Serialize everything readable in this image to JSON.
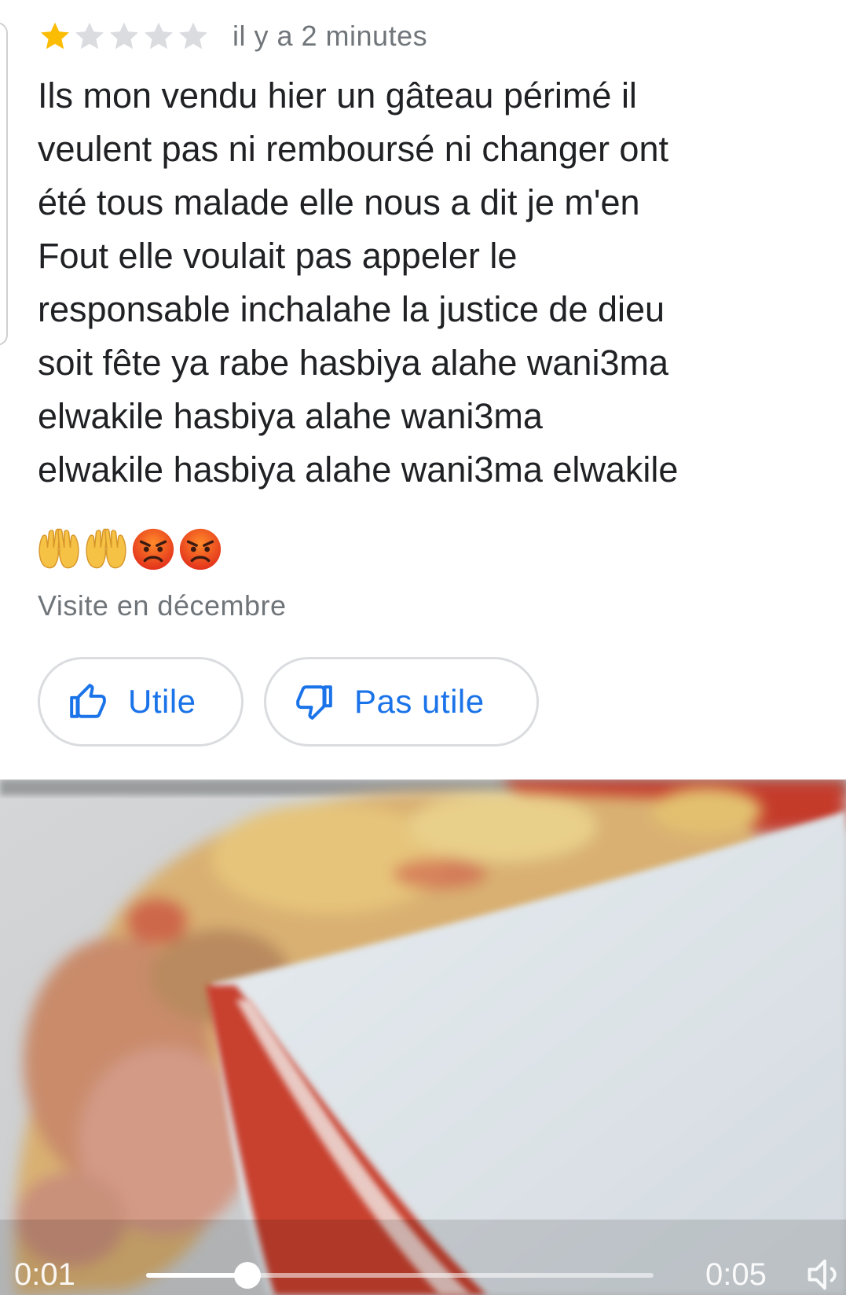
{
  "review": {
    "rating": 1,
    "rating_max": 5,
    "timestamp": "il y a 2 minutes",
    "text": "Ils mon vendu hier un gâteau périmé il\nveulent pas ni remboursé ni changer ont\nété tous malade elle  nous a dit  je m'en\nFout elle  voulait pas appeler le\nresponsable inchalahe  la justice de dieu\nsoit fête ya rabe hasbiya alahe  wani3ma\nelwakile hasbiya alahe  wani3ma\nelwakile hasbiya alahe  wani3ma elwakile",
    "emojis": [
      "palms-up-icon",
      "palms-up-icon",
      "angry-face-icon",
      "angry-face-icon"
    ],
    "visit": "Visite en décembre"
  },
  "actions": {
    "helpful_label": "Utile",
    "not_helpful_label": "Pas utile"
  },
  "video": {
    "current_time": "0:01",
    "total_time": "0:05",
    "progress": 0.2
  },
  "colors": {
    "star_filled": "#fbbc04",
    "star_empty": "#dadce0",
    "accent": "#1a73e8",
    "text": "#202124",
    "secondary": "#70757a"
  }
}
